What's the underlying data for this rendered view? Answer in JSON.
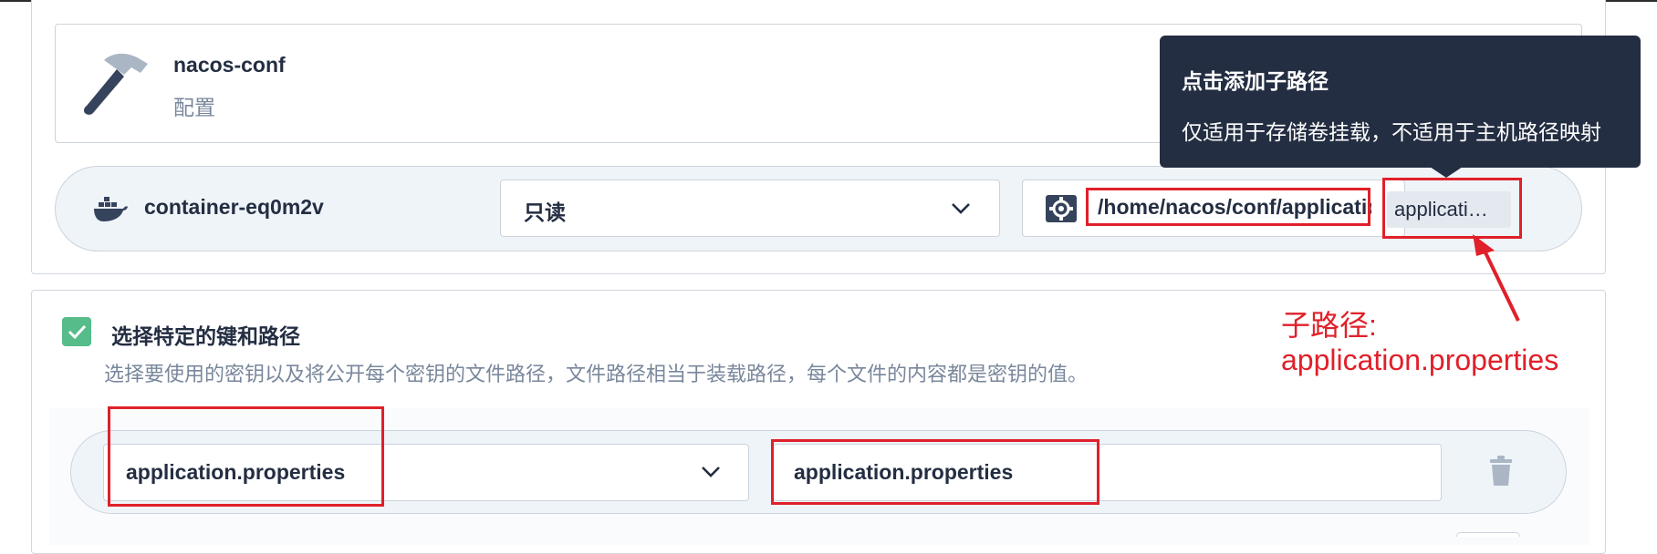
{
  "config": {
    "name": "nacos-conf",
    "type_label": "配置"
  },
  "mount": {
    "container_name": "container-eq0m2v",
    "access_mode": "只读",
    "mount_path": "/home/nacos/conf/application.properties",
    "sub_path_tag": "applicati…"
  },
  "tooltip": {
    "title": "点击添加子路径",
    "body": "仅适用于存储卷挂载，不适用于主机路径映射"
  },
  "keys_section": {
    "checked": true,
    "title": "选择特定的键和路径",
    "description": "选择要使用的密钥以及将公开每个密钥的文件路径，文件路径相当于装载路径，每个文件的内容都是密钥的值。",
    "rows": [
      {
        "key": "application.properties",
        "path": "application.properties"
      }
    ]
  },
  "annotation": {
    "line1": "子路径:",
    "line2": "application.properties",
    "color": "#e0202a"
  },
  "colors": {
    "tooltip_bg": "#242e42",
    "checkbox_green": "#55bc8a",
    "row_bg": "#eff4f9"
  }
}
